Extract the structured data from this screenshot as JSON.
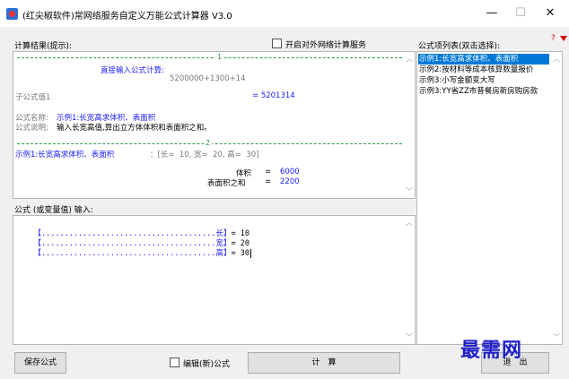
{
  "window": {
    "title": "(红尖椒软件)常网络服务自定义万能公式计算器 V3.0",
    "minimize": "—",
    "maximize": "☐",
    "close": "✕"
  },
  "result_section": {
    "label": "计算结果(提示):",
    "network_service_label": "开启对外网络计算服务",
    "network_service_checked": false
  },
  "result": {
    "separator1": "1",
    "direct_input_title": "直接输入公式计算:",
    "direct_expr": "5200000+1300+14",
    "sub_formula_label": "子公式值1",
    "sub_formula_value": "= 5201314",
    "formula_name_label": "公式名称:",
    "formula_name_value": "示例1:长宽高求体积、表面积",
    "formula_desc_label": "公式说明:",
    "formula_desc_value": "输入长宽高值,算出立方体体积和表面积之和。",
    "separator2": "2",
    "example_line_name": "示例1:长宽高求体积、表面积",
    "example_line_params": "：[长=  10, 宽=  20, 高=  30]",
    "volume_label": "体积",
    "volume_eq": "=",
    "volume_value": "6000",
    "surface_label": "表面积之和",
    "surface_eq": "=",
    "surface_value": "2200"
  },
  "input_section": {
    "label": "公式 (或变量值) 输入:",
    "lines": [
      {
        "open": "【",
        "dots": "......................................",
        "var": "长",
        "close": "】",
        "value": "= 10"
      },
      {
        "open": "【",
        "dots": "......................................",
        "var": "宽",
        "close": "】",
        "value": "= 20"
      },
      {
        "open": "【",
        "dots": "......................................",
        "var": "高",
        "close": "】",
        "value": "= 30"
      }
    ]
  },
  "formula_list": {
    "label": "公式项列表(双击选择):",
    "help": "?",
    "items": [
      {
        "label": "示例1:长宽高求体积、表面积",
        "selected": true
      },
      {
        "label": "示例2:按材料等成本核算数量报价",
        "selected": false
      },
      {
        "label": "示例3:小写金额变大写",
        "selected": false
      },
      {
        "label": "示例3:YY省ZZ市普餐房新房购房款",
        "selected": false
      }
    ]
  },
  "buttons": {
    "save": "保存公式",
    "edit_new_label": "编辑(新)公式",
    "calculate": "计　算",
    "exit": "退　出"
  },
  "watermark": "最需网"
}
